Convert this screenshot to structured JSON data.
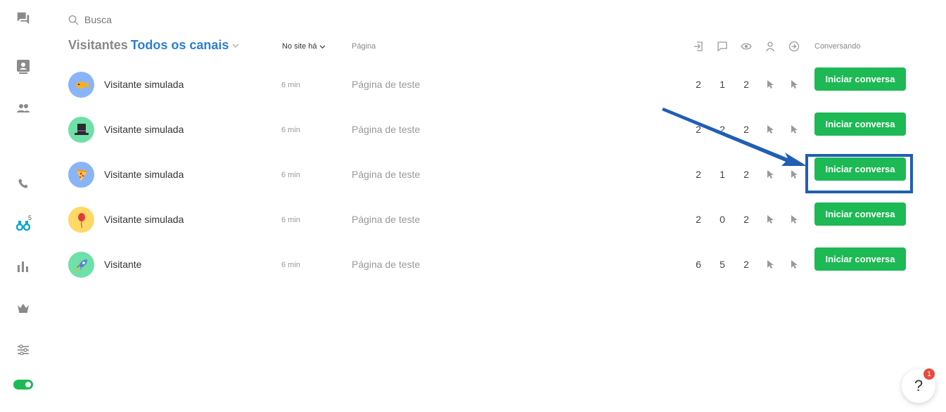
{
  "search": {
    "placeholder": "Busca"
  },
  "header": {
    "title": "Visitantes",
    "channel_filter": "Todos os canais"
  },
  "columns": {
    "sort_label": "No site há",
    "page_label": "Página",
    "talking_label": "Conversando"
  },
  "sidebar": {
    "monitor_badge": "5"
  },
  "visitors": [
    {
      "name": "Visitante simulada",
      "time": "6 min",
      "page": "Página de teste",
      "c1": "2",
      "c2": "1",
      "c3": "2",
      "avatar_color": "#8ab4f8",
      "button": "Iniciar conversa"
    },
    {
      "name": "Visitante simulada",
      "time": "6 min",
      "page": "Página de teste",
      "c1": "2",
      "c2": "2",
      "c3": "2",
      "avatar_color": "#6ee0a8",
      "button": "Iniciar conversa"
    },
    {
      "name": "Visitante simulada",
      "time": "6 min",
      "page": "Página de teste",
      "c1": "2",
      "c2": "1",
      "c3": "2",
      "avatar_color": "#8ab4f8",
      "button": "Iniciar conversa"
    },
    {
      "name": "Visitante simulada",
      "time": "6 min",
      "page": "Página de teste",
      "c1": "2",
      "c2": "0",
      "c3": "2",
      "avatar_color": "#ffd866",
      "button": "Iniciar conversa"
    },
    {
      "name": "Visitante",
      "time": "6 min",
      "page": "Página de teste",
      "c1": "6",
      "c2": "5",
      "c3": "2",
      "avatar_color": "#6ee0a8",
      "button": "Iniciar conversa"
    }
  ],
  "help": {
    "label": "?",
    "badge": "1"
  },
  "colors": {
    "accent_green": "#1db954",
    "link_blue": "#2b7fd4",
    "highlight_blue": "#1f5fb4"
  }
}
